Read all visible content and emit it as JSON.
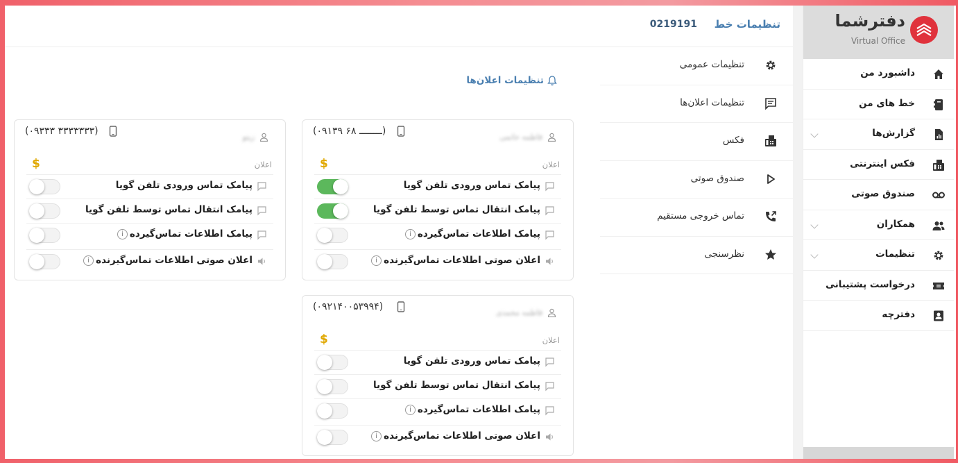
{
  "brand": {
    "name": "دفترشما",
    "subtitle": "Virtual Office"
  },
  "sidebar": {
    "items": [
      {
        "label": "داشبورد من",
        "icon": "home-icon",
        "chevron": false
      },
      {
        "label": "خط های من",
        "icon": "phone-lines-icon",
        "chevron": false
      },
      {
        "label": "گزارش‌ها",
        "icon": "report-icon",
        "chevron": true
      },
      {
        "label": "فکس اینترنتی",
        "icon": "fax-icon",
        "chevron": false
      },
      {
        "label": "صندوق صوتی",
        "icon": "voicemail-icon",
        "chevron": false
      },
      {
        "label": "همکاران",
        "icon": "people-icon",
        "chevron": true
      },
      {
        "label": "تنظیمات",
        "icon": "gear-icon",
        "chevron": true
      },
      {
        "label": "درخواست پشتیبانی",
        "icon": "ticket-icon",
        "chevron": false
      },
      {
        "label": "دفترچه",
        "icon": "contact-book-icon",
        "chevron": false
      }
    ]
  },
  "header": {
    "title": "تنظیمات خط",
    "line_number": "0219191"
  },
  "menu": {
    "items": [
      {
        "label": "تنظیمات عمومی",
        "icon": "gear-icon"
      },
      {
        "label": "تنظیمات اعلان‌ها",
        "icon": "message-icon"
      },
      {
        "label": "فکس",
        "icon": "fax-icon"
      },
      {
        "label": "صندوق صوتی",
        "icon": "play-icon"
      },
      {
        "label": "تماس خروجی مستقیم",
        "icon": "phone-outgoing-icon"
      },
      {
        "label": "نظرسنجی",
        "icon": "star-icon"
      }
    ]
  },
  "content": {
    "title": "تنظیمات اعلان‌ها"
  },
  "cards": [
    {
      "phone": "(۰۹۱۳۹ ــــــــ ۶۸)",
      "user": "فاطمه حاتمی",
      "announce_label": "اعلان",
      "currency": "$",
      "rows": [
        {
          "label": "پیامک تماس ورودی تلفن گویا",
          "icon": "sms-icon",
          "info": false,
          "on": true
        },
        {
          "label": "پیامک انتقال تماس توسط تلفن گویا",
          "icon": "sms-icon",
          "info": false,
          "on": true
        },
        {
          "label": "پیامک اطلاعات تماس‌گیرده",
          "icon": "sms-icon",
          "info": true,
          "on": false
        },
        {
          "label": "اعلان صوتی اطلاعات تماس‌گیرنده",
          "icon": "speaker-icon",
          "info": true,
          "on": false
        }
      ]
    },
    {
      "phone": "(۰۹۳۳۳ ۳۳۳۳۳۳۳)",
      "user": "زیتو",
      "announce_label": "اعلان",
      "currency": "$",
      "rows": [
        {
          "label": "پیامک تماس ورودی تلفن گویا",
          "icon": "sms-icon",
          "info": false,
          "on": false
        },
        {
          "label": "پیامک انتقال تماس توسط تلفن گویا",
          "icon": "sms-icon",
          "info": false,
          "on": false
        },
        {
          "label": "پیامک اطلاعات تماس‌گیرده",
          "icon": "sms-icon",
          "info": true,
          "on": false
        },
        {
          "label": "اعلان صوتی اطلاعات تماس‌گیرنده",
          "icon": "speaker-icon",
          "info": true,
          "on": false
        }
      ]
    },
    {
      "phone": "(۰۹۲۱۴۰۰۵۳۹۹۴)",
      "user": "فاطمه محمدی",
      "announce_label": "اعلان",
      "currency": "$",
      "rows": [
        {
          "label": "پیامک تماس ورودی تلفن گویا",
          "icon": "sms-icon",
          "info": false,
          "on": false
        },
        {
          "label": "پیامک انتقال تماس توسط تلفن گویا",
          "icon": "sms-icon",
          "info": false,
          "on": false
        },
        {
          "label": "پیامک اطلاعات تماس‌گیرده",
          "icon": "sms-icon",
          "info": true,
          "on": false
        },
        {
          "label": "اعلان صوتی اطلاعات تماس‌گیرنده",
          "icon": "speaker-icon",
          "info": true,
          "on": false
        }
      ]
    }
  ],
  "info_glyph": "i",
  "colors": {
    "brand_red": "#e0323c",
    "accent_blue": "#4a7fb0",
    "toggle_on": "#5cb85c",
    "currency": "#e0a800"
  }
}
